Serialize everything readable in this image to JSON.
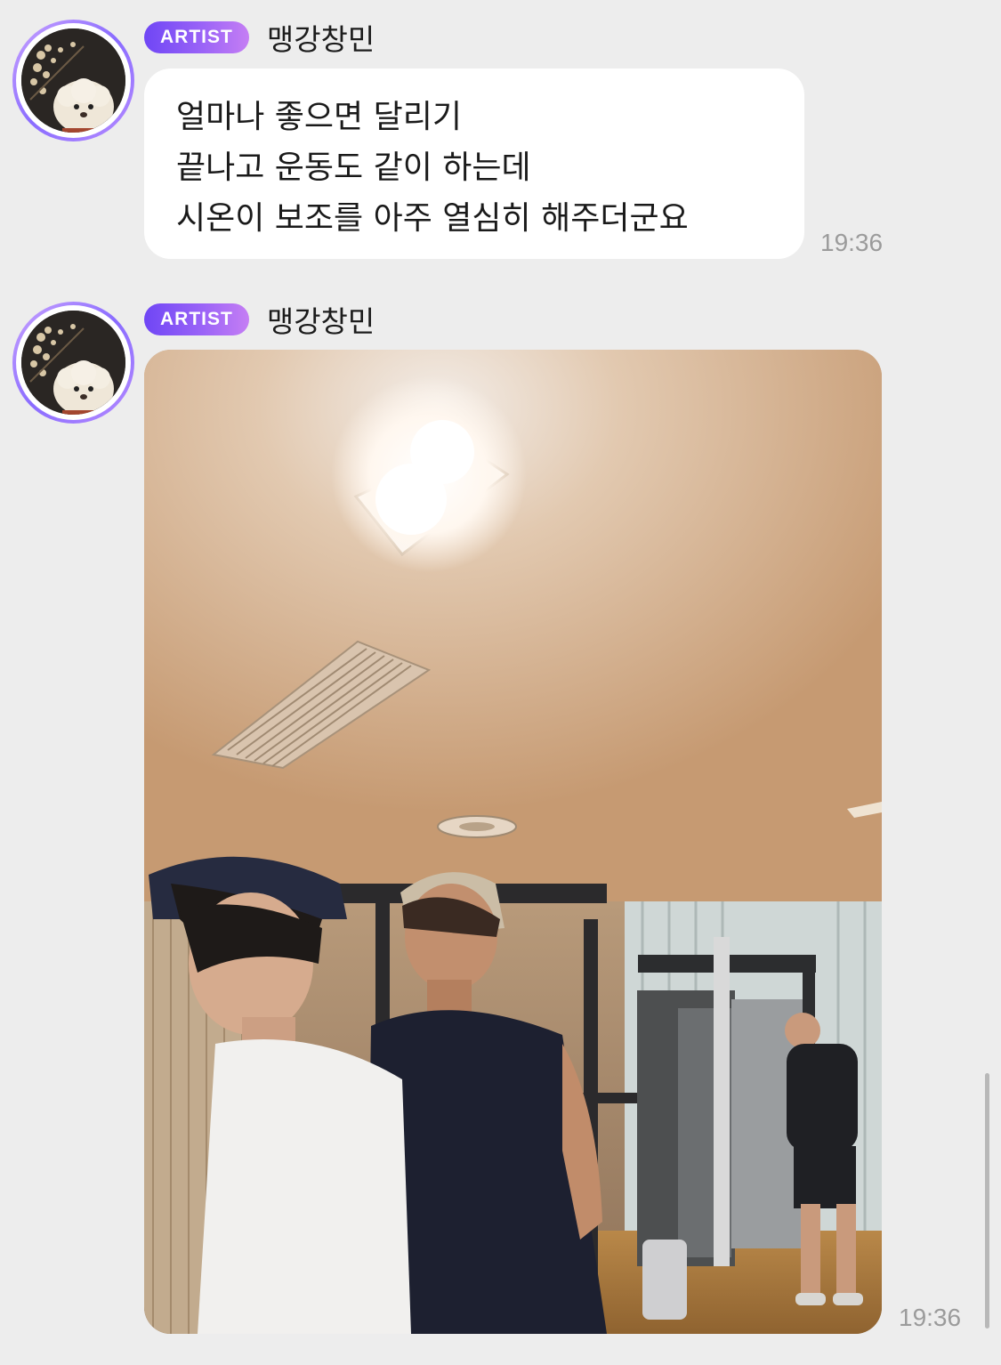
{
  "messages": [
    {
      "badge": "ARTIST",
      "sender": "맹강창민",
      "lines": [
        "얼마나 좋으면 달리기",
        "끝나고 운동도 같이 하는데",
        "시온이 보조를 아주 열심히 해주더군요"
      ],
      "time": "19:36"
    },
    {
      "badge": "ARTIST",
      "sender": "맹강창민",
      "time": "19:36"
    }
  ],
  "colors": {
    "background": "#ededed",
    "bubble": "#ffffff",
    "badge_start": "#6f46f5",
    "badge_end": "#c57ef4",
    "timestamp": "#9b9b9b"
  },
  "icons": {
    "avatar": "profile-photo-dog",
    "photo": "gym-photo"
  }
}
